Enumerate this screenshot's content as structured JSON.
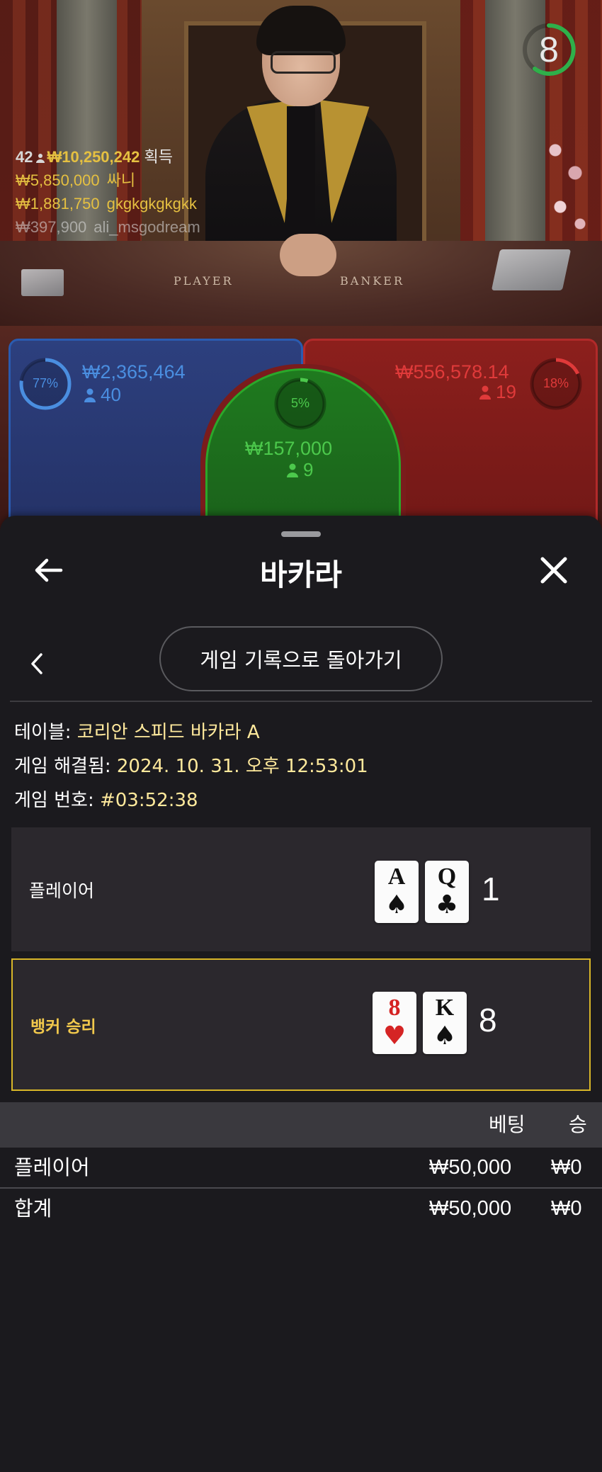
{
  "timer": {
    "value": "8"
  },
  "winners": {
    "count": "42",
    "total": "₩10,250,242",
    "total_label": "획득",
    "list": [
      {
        "amount": "₩5,850,000",
        "name": "싸니"
      },
      {
        "amount": "₩1,881,750",
        "name": "gkgkgkgkgkk"
      },
      {
        "amount": "₩397,900",
        "name": "ali_msgodream"
      }
    ]
  },
  "table_labels": {
    "player": "PLAYER",
    "banker": "BANKER"
  },
  "bets": {
    "player": {
      "percent": "77%",
      "percent_value": 0.77,
      "amount": "₩2,365,464",
      "players": "40",
      "color": "#4a8ee0"
    },
    "tie": {
      "percent": "5%",
      "percent_value": 0.05,
      "amount": "₩157,000",
      "players": "9",
      "color": "#4cc94c"
    },
    "banker": {
      "percent": "18%",
      "percent_value": 0.18,
      "amount": "₩556,578.14",
      "players": "19",
      "color": "#e03a3a"
    }
  },
  "sheet": {
    "title": "바카라",
    "back_history_button": "게임 기록으로 돌아가기",
    "info": {
      "table_label": "테이블:",
      "table_value": "코리안 스피드 바카라 A",
      "resolved_label": "게임 해결됨:",
      "resolved_value": "2024. 10. 31. 오후 12:53:01",
      "game_no_label": "게임 번호:",
      "game_no_value": "#03:52:38"
    },
    "result": {
      "player": {
        "label": "플레이어",
        "cards": [
          {
            "rank": "A",
            "suit": "♠",
            "color": "black"
          },
          {
            "rank": "Q",
            "suit": "♣",
            "color": "black"
          }
        ],
        "score": "1"
      },
      "banker": {
        "label": "뱅커 승리",
        "cards": [
          {
            "rank": "8",
            "suit": "♥",
            "color": "red"
          },
          {
            "rank": "K",
            "suit": "♠",
            "color": "black"
          }
        ],
        "score": "8"
      }
    },
    "bets_table": {
      "headers": {
        "bet": "베팅",
        "win": "승"
      },
      "rows": [
        {
          "label": "플레이어",
          "bet": "₩50,000",
          "win": "₩0"
        }
      ],
      "total": {
        "label": "합계",
        "bet": "₩50,000",
        "win": "₩0"
      }
    }
  },
  "colors": {
    "accent_gold": "#e5c041",
    "highlight_border": "#d8b628",
    "sheet_bg": "#1b1a1e"
  }
}
